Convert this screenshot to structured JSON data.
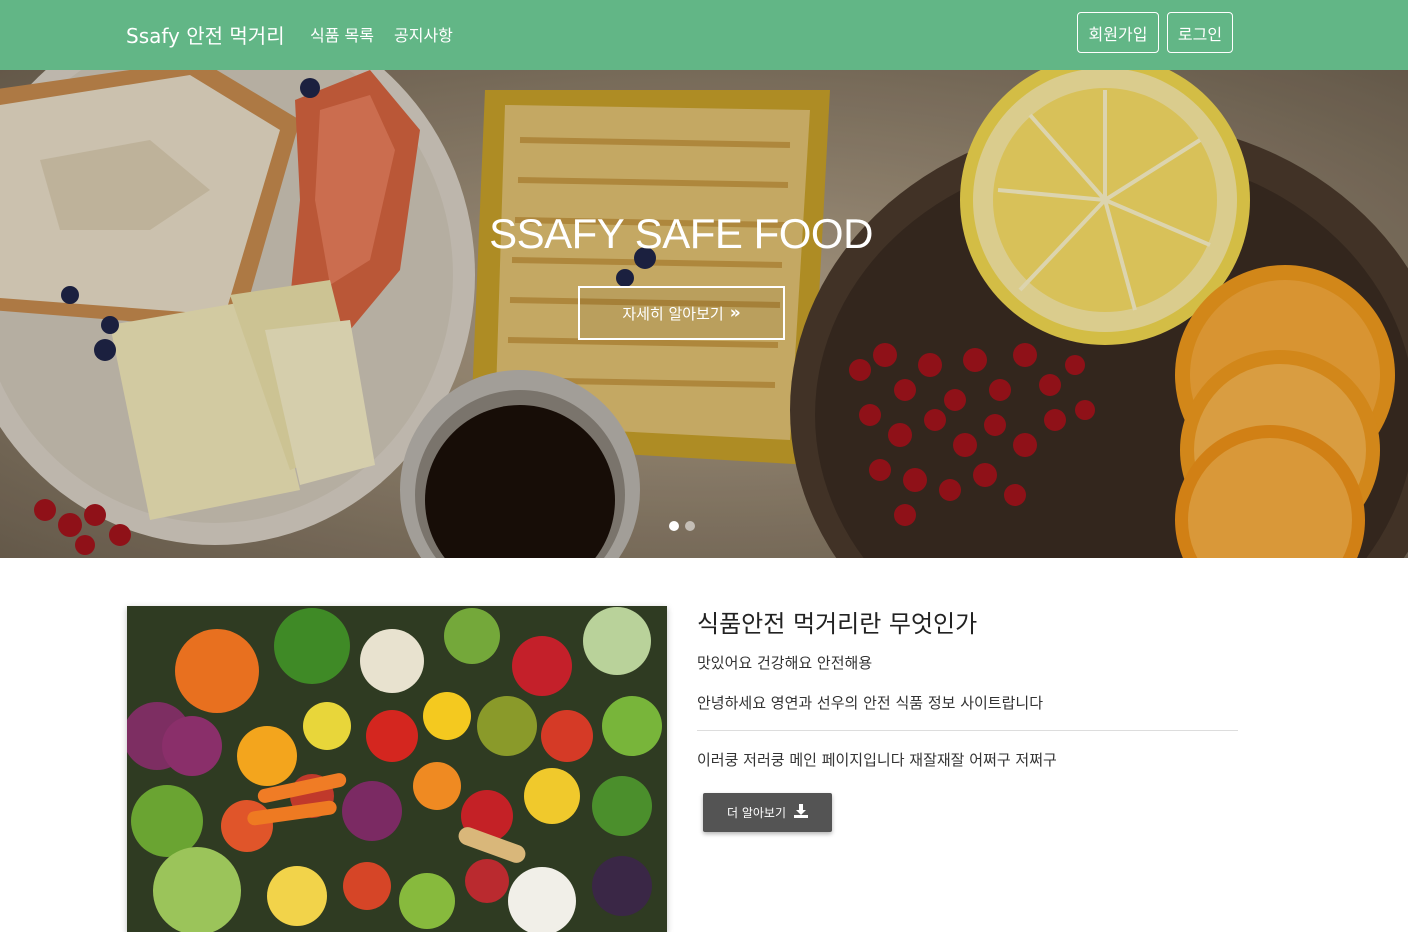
{
  "navbar": {
    "brand": "Ssafy 안전 먹거리",
    "links": [
      {
        "label": "식품 목록"
      },
      {
        "label": "공지사항"
      }
    ],
    "signup_label": "회원가입",
    "login_label": "로그인",
    "background_color": "#62b686"
  },
  "hero": {
    "title": "SSAFY SAFE FOOD",
    "button_label": "자세히 알아보기",
    "button_icon": "double-chevron-right-icon",
    "active_slide": 1,
    "slide_count": 2
  },
  "about": {
    "title": "식품안전 먹거리란 무엇인가",
    "paragraph1": "맛있어요 건강해요 안전해용",
    "paragraph2": "안녕하세요 영연과 선우의 안전 식품 정보 사이트랍니다",
    "paragraph3": "이러쿵 저러쿵 메인 페이지입니다 재잘재잘 어쩌구 저쩌구",
    "button_label": "더 알아보기",
    "button_icon": "download-icon",
    "button_color": "#545454"
  }
}
